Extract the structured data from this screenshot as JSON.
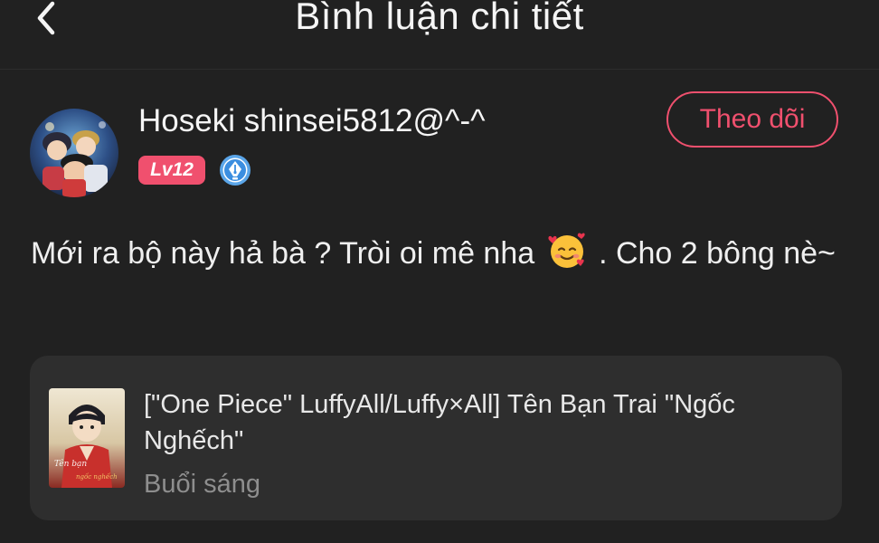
{
  "header": {
    "title": "Bình luận chi tiết",
    "back_icon": "chevron-left-icon"
  },
  "user": {
    "name": "Hoseki shinsei5812@^-^",
    "level": "Lv12",
    "avatar_icon": "avatar-image",
    "verify_icon": "pen-nib-badge-icon",
    "follow_label": "Theo dõi"
  },
  "comment": {
    "text_before_emoji": "Mới ra bộ này hả bà ? Tròi oi mê nha",
    "emoji": "smiling-face-with-hearts-icon",
    "text_after_emoji": ". Cho 2 bông nè~"
  },
  "story": {
    "title": "[\"One Piece\" LuffyAll/Luffy×All] Tên Bạn Trai \"Ngốc Nghếch\"",
    "subtitle": "Buổi sáng",
    "cover_icon": "book-cover-image"
  },
  "colors": {
    "background": "#212121",
    "card": "#2e2e2e",
    "accent": "#f0506e",
    "text": "#f2f2f2",
    "muted": "#8e8e8e"
  }
}
